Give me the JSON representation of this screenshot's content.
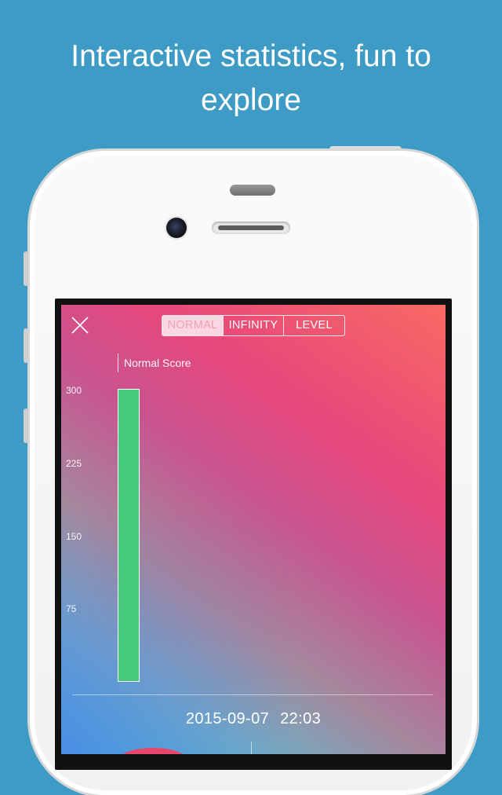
{
  "headline": {
    "line1": "Interactive statistics, fun to",
    "line2": "explore"
  },
  "screen": {
    "close_icon": "close-icon",
    "tabs": [
      {
        "label": "NORMAL",
        "active": true
      },
      {
        "label": "INFINITY",
        "active": false
      },
      {
        "label": "LEVEL",
        "active": false
      }
    ],
    "legend_label": "Normal Score",
    "timestamp_date": "2015-09-07",
    "timestamp_time": "22:03"
  },
  "chart_data": {
    "type": "bar",
    "categories": [
      "2015-09-07 22:03"
    ],
    "series": [
      {
        "name": "Normal Score",
        "values": [
          300
        ],
        "color": "#46c97a"
      }
    ],
    "ylim": [
      0,
      300
    ],
    "yticks": [
      "300",
      "225",
      "150",
      "75"
    ],
    "xlabel": "",
    "ylabel": ""
  },
  "colors": {
    "background": "#3d9bc6",
    "bar": "#46c97a",
    "gradient_top_right": "#f86a63",
    "gradient_bottom_right": "#2ccbdc",
    "gradient_bottom_left": "#7a6be8"
  }
}
